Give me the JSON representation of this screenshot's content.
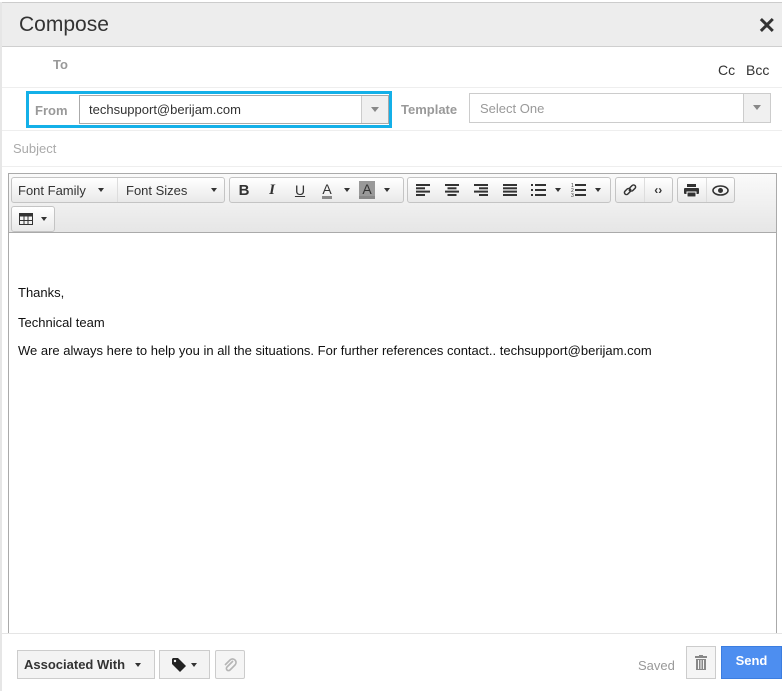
{
  "header": {
    "title": "Compose",
    "close_icon": "close-icon"
  },
  "recipients": {
    "to_label": "To",
    "cc_label": "Cc",
    "bcc_label": "Bcc"
  },
  "from": {
    "label": "From",
    "value": "techsupport@berijam.com"
  },
  "template": {
    "label": "Template",
    "placeholder": "Select One"
  },
  "subject": {
    "placeholder": "Subject"
  },
  "toolbar": {
    "font_family": "Font Family",
    "font_sizes": "Font Sizes",
    "bold": "B",
    "italic": "I",
    "underline": "U",
    "text_color": "A",
    "bg_color": "A"
  },
  "body": {
    "lines": [
      "Thanks,",
      "Technical team",
      "We are always here to help you in all the situations. For further references contact.. techsupport@berijam.com"
    ]
  },
  "footer": {
    "associated_with": "Associated With",
    "status": "Saved",
    "send": "Send"
  },
  "colors": {
    "accent": "#14b0e8",
    "send": "#4d8ef0"
  }
}
